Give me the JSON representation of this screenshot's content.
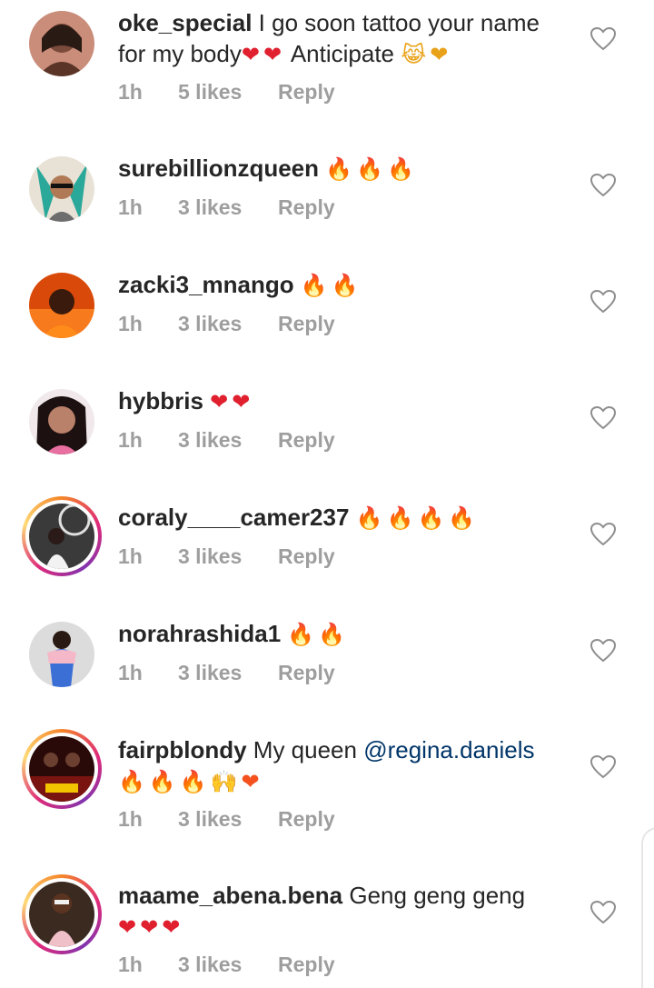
{
  "comments": [
    {
      "username": "oke_special",
      "text": " I go soon tattoo your name for my body",
      "emoji_html": "❤❤",
      "text2": " Anticipate ",
      "emoji2": "😹❤",
      "time": "1h",
      "likes": "5 likes",
      "reply": "Reply",
      "avatar_ring": false
    },
    {
      "username": "surebillionzqueen",
      "text": " ",
      "emoji_html": "🔥🔥🔥",
      "time": "1h",
      "likes": "3 likes",
      "reply": "Reply",
      "avatar_ring": false
    },
    {
      "username": "zacki3_mnango",
      "text": " ",
      "emoji_html": "🔥🔥",
      "time": "1h",
      "likes": "3 likes",
      "reply": "Reply",
      "avatar_ring": false
    },
    {
      "username": "hybbris",
      "text": " ",
      "emoji_html": "❤❤",
      "time": "1h",
      "likes": "3 likes",
      "reply": "Reply",
      "avatar_ring": false
    },
    {
      "username": "coraly____camer237",
      "text": " ",
      "emoji_html": "🔥🔥🔥🔥",
      "time": "1h",
      "likes": "3 likes",
      "reply": "Reply",
      "avatar_ring": true
    },
    {
      "username": "norahrashida1",
      "text": " ",
      "emoji_html": "🔥🔥",
      "time": "1h",
      "likes": "3 likes",
      "reply": "Reply",
      "avatar_ring": false
    },
    {
      "username": "fairpblondy",
      "text": " My queen ",
      "mention": "@regina.daniels",
      "emoji_html": "🔥🔥🔥🙌❤",
      "time": "1h",
      "likes": "3 likes",
      "reply": "Reply",
      "avatar_ring": true
    },
    {
      "username": "maame_abena.bena",
      "text": " Geng geng geng",
      "emoji_html": "❤❤❤",
      "time": "1h",
      "likes": "3 likes",
      "reply": "Reply",
      "avatar_ring": true
    }
  ],
  "icons": {
    "like": "heart-outline-icon"
  },
  "colors": {
    "text": "#262626",
    "meta": "#9e9e9e",
    "mention": "#003569",
    "story_ring_start": "#f58529",
    "story_ring_end": "#dd2a7b"
  }
}
